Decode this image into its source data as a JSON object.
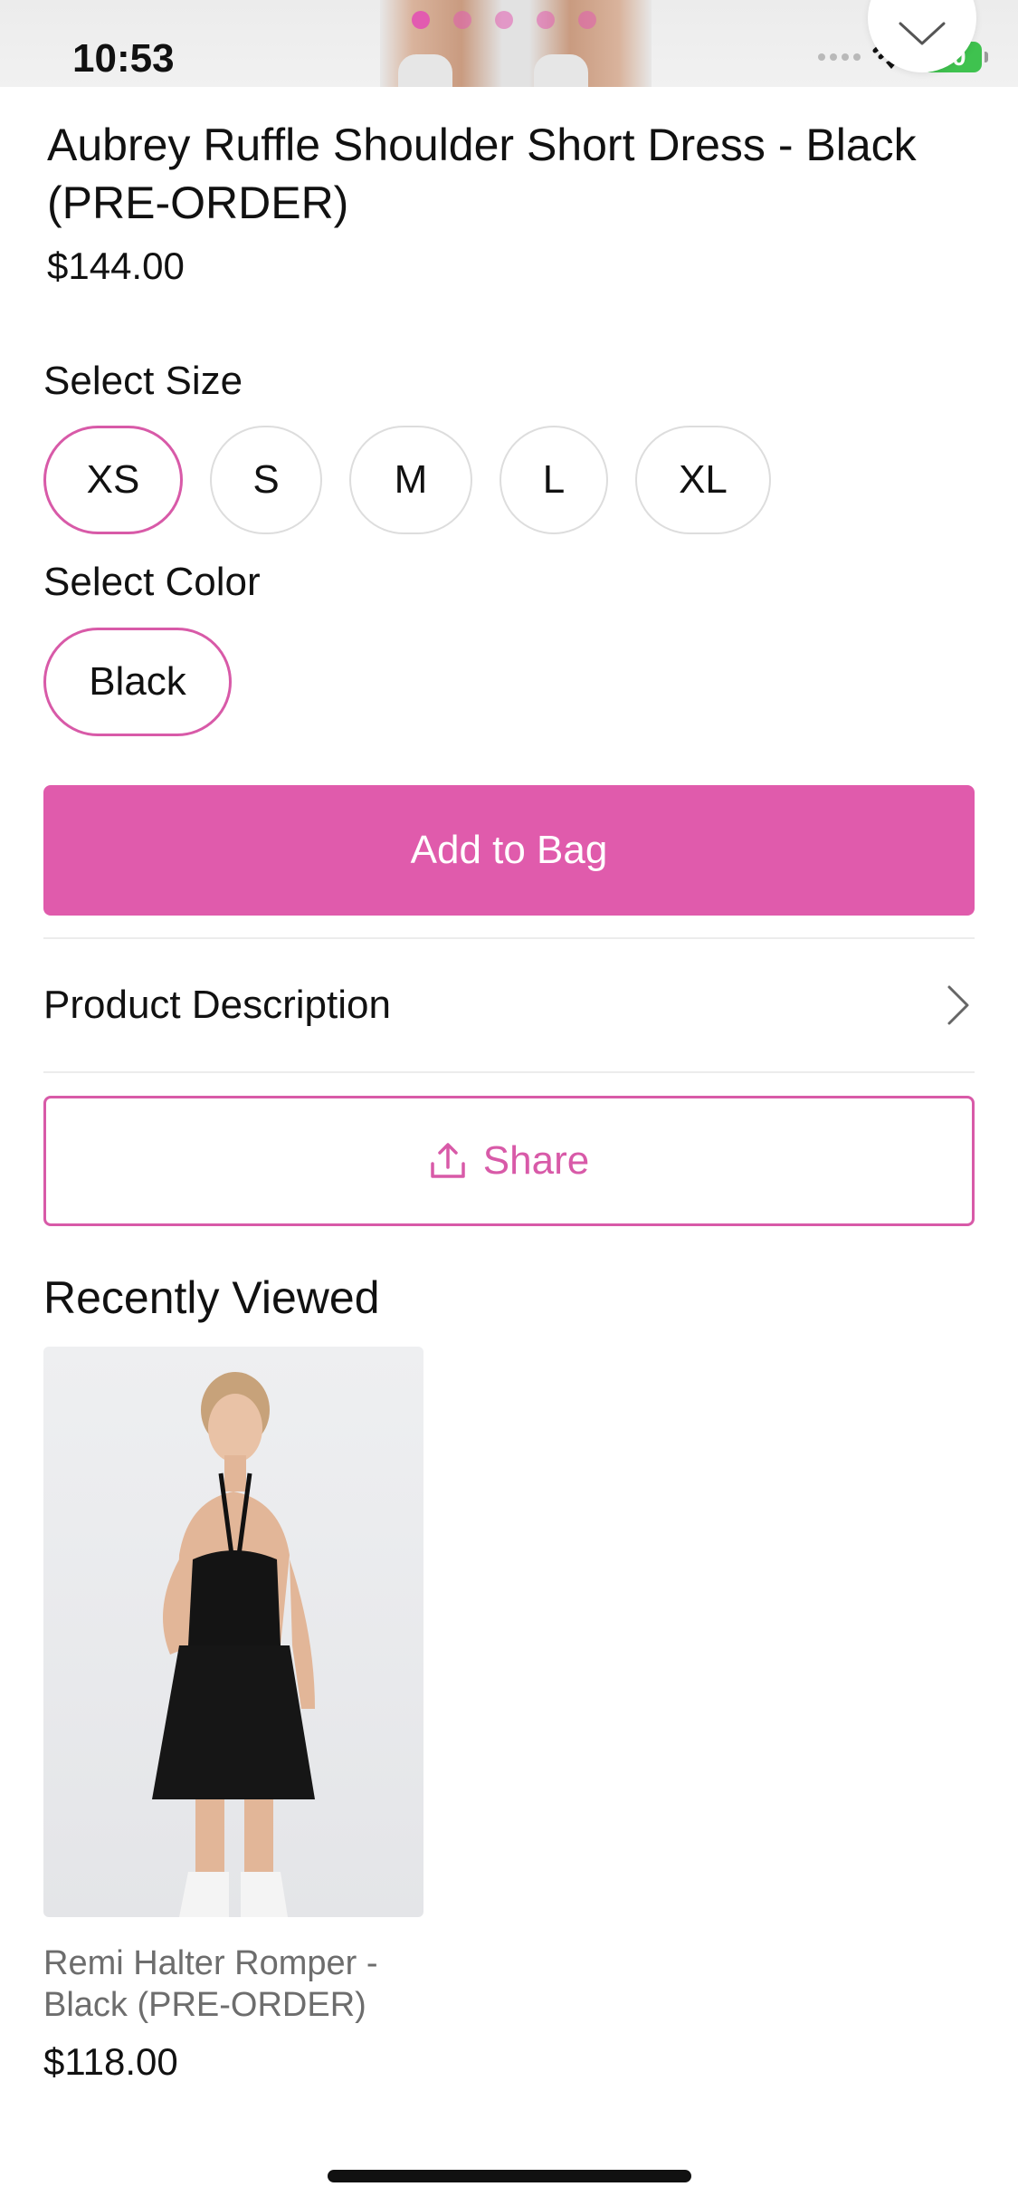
{
  "status_bar": {
    "time": "10:53",
    "battery": "80"
  },
  "gallery": {
    "dot_count": 5,
    "active_index": 0,
    "accent": "#e25bb0"
  },
  "product": {
    "title": "Aubrey Ruffle Shoulder Short Dress - Black (PRE-ORDER)",
    "price": "$144.00"
  },
  "size": {
    "label": "Select Size",
    "options": [
      "XS",
      "S",
      "M",
      "L",
      "XL"
    ],
    "selected": "XS"
  },
  "color": {
    "label": "Select Color",
    "options": [
      "Black"
    ],
    "selected": "Black"
  },
  "actions": {
    "add_to_bag": "Add to Bag",
    "product_description": "Product Description",
    "share": "Share"
  },
  "recently_viewed": {
    "title": "Recently Viewed",
    "items": [
      {
        "name": "Remi Halter Romper - Black (PRE-ORDER)",
        "price": "$118.00"
      }
    ]
  },
  "colors": {
    "brand_pink": "#e05bac",
    "outline_pink": "#d85aa8",
    "battery_green": "#3fc24f"
  },
  "icons": {
    "favorite": "heart-outline-icon",
    "chevron": "chevron-right-icon",
    "share": "share-upload-icon",
    "wifi": "wifi-icon"
  }
}
